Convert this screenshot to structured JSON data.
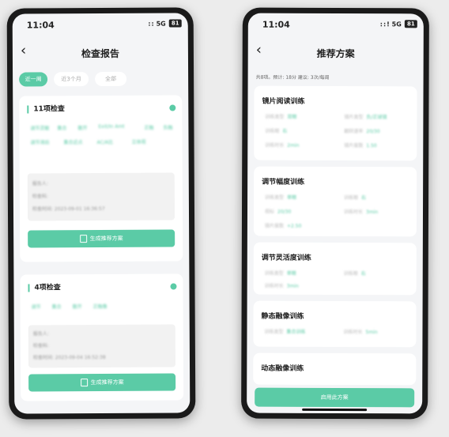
{
  "left": {
    "status": {
      "time": "11:04",
      "signal": "::",
      "network": "5G",
      "battery": "81"
    },
    "title": "检查报告",
    "tabs": [
      "近一周",
      "近3个月",
      "全部"
    ],
    "cards": [
      {
        "title": "11项检查",
        "chips": [
          "调节灵敏",
          "集合",
          "散开",
          "Exit/In Amt",
          "正融",
          "负融",
          "调节滞后",
          "集合近点",
          "AC/A比",
          "立体视"
        ],
        "info": [
          "报告人:",
          "检查科:",
          "检查时间: 2023-09-01 16:36:57"
        ],
        "button": "生成推荐方案"
      },
      {
        "title": "4项检查",
        "chips": [
          "调节",
          "集合",
          "散开",
          "正融像"
        ],
        "info": [
          "报告人:",
          "检查科:",
          "检查时间: 2023-09-04 16:52:38"
        ],
        "button": "生成推荐方案"
      }
    ]
  },
  "right": {
    "status": {
      "time": "11:04",
      "signal": "::!",
      "network": "5G",
      "battery": "81"
    },
    "title": "推荐方案",
    "summary": "共8项。预计: 18分  建议: 3次/每周",
    "plans": [
      {
        "title": "镜片阅读训练",
        "fields": [
          [
            "训练类型",
            "双眼"
          ],
          [
            "镜片类型",
            "负/正球镜"
          ],
          [
            "训练眼",
            "右"
          ],
          [
            "翻转速率",
            "20/30"
          ],
          [
            "训练时长",
            "2min"
          ],
          [
            "镜片度数",
            "1.50"
          ]
        ]
      },
      {
        "title": "调节幅度训练",
        "fields": [
          [
            "训练类型",
            "单眼"
          ],
          [
            "训练眼",
            "右"
          ],
          [
            "视标",
            "20/30"
          ],
          [
            "训练时长",
            "3min"
          ],
          [
            "镜片度数",
            "+2.50"
          ]
        ]
      },
      {
        "title": "调节灵活度训练",
        "fields": [
          [
            "训练类型",
            "单眼"
          ],
          [
            "训练眼",
            "右"
          ],
          [
            "训练时长",
            "3min"
          ]
        ]
      },
      {
        "title": "静态融像训练",
        "fields": [
          [
            "训练类型",
            "集合训练"
          ],
          [
            "训练时长",
            "5min"
          ]
        ]
      },
      {
        "title": "动态融像训练",
        "fields": []
      }
    ],
    "apply_button": "启用此方案"
  }
}
